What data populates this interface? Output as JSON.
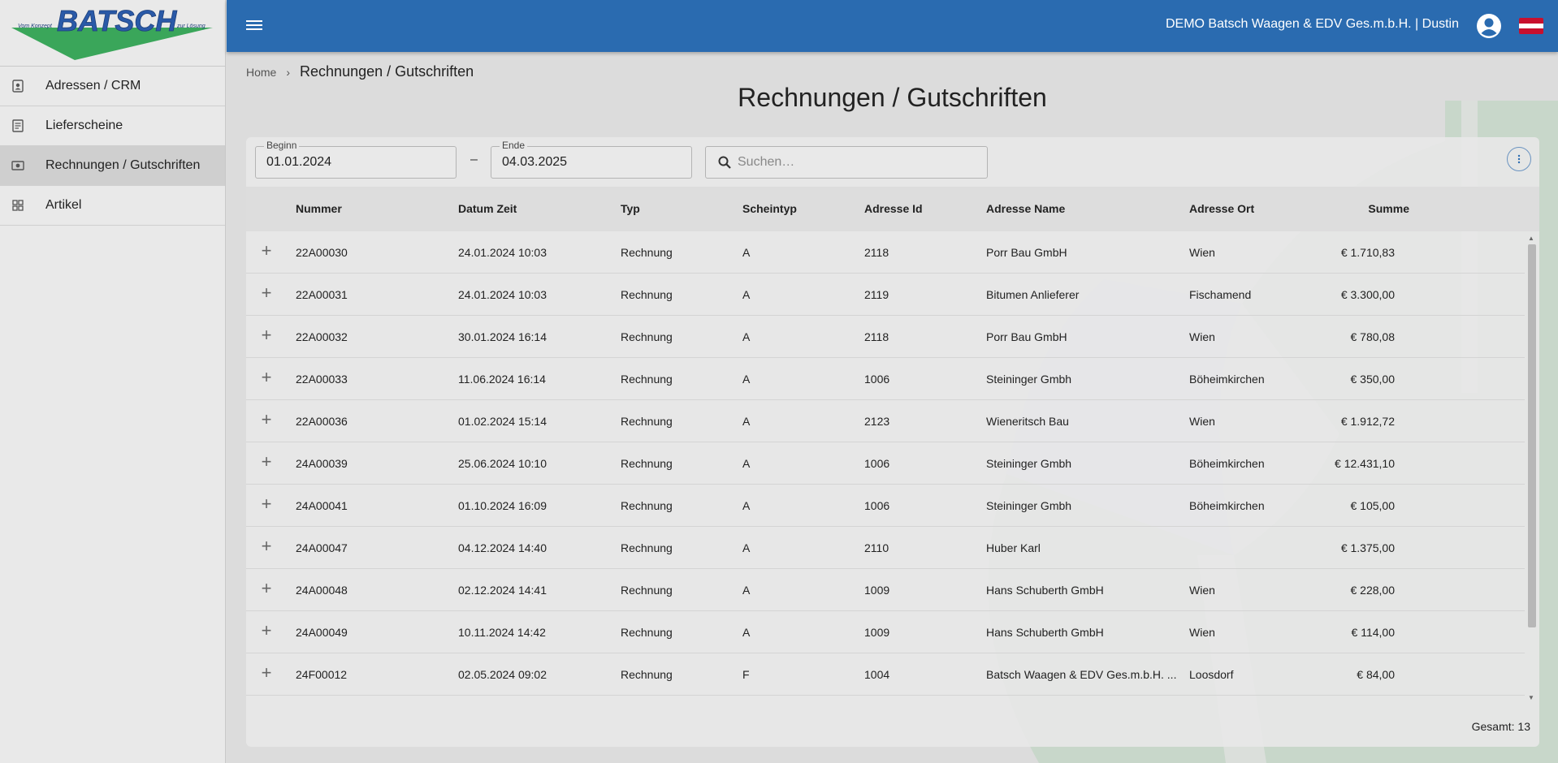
{
  "logo": {
    "brand": "BATSCH",
    "tagline_left": "Vom Konzept",
    "tagline_right": "zur Lösung",
    "colors": {
      "text": "#2a5aa8",
      "triangle": "#3aa65a"
    }
  },
  "sidebar": {
    "items": [
      {
        "label": "Adressen / CRM",
        "icon": "contact-icon",
        "active": false
      },
      {
        "label": "Lieferscheine",
        "icon": "document-icon",
        "active": false
      },
      {
        "label": "Rechnungen / Gutschriften",
        "icon": "money-icon",
        "active": true
      },
      {
        "label": "Artikel",
        "icon": "grid-icon",
        "active": false
      }
    ]
  },
  "header": {
    "title": "DEMO Batsch Waagen & EDV Ges.m.b.H. | Dustin",
    "color": "#2a6bb0",
    "menu_icon": "hamburger-icon",
    "user_icon": "account-circle-icon",
    "flag_icon": "austria-flag-icon",
    "flag_colors": [
      "#c8102e",
      "#ffffff",
      "#c8102e"
    ]
  },
  "breadcrumb": {
    "home": "Home",
    "current": "Rechnungen / Gutschriften"
  },
  "page": {
    "title": "Rechnungen / Gutschriften"
  },
  "filters": {
    "begin_label": "Beginn",
    "begin_value": "01.01.2024",
    "separator": "–",
    "end_label": "Ende",
    "end_value": "04.03.2025",
    "search_placeholder": "Suchen…"
  },
  "table": {
    "columns": {
      "nummer": "Nummer",
      "datum": "Datum Zeit",
      "typ": "Typ",
      "scheintyp": "Scheintyp",
      "adresse_id": "Adresse Id",
      "adresse_name": "Adresse Name",
      "adresse_ort": "Adresse Ort",
      "summe": "Summe"
    },
    "expand_symbol": "+",
    "rows": [
      {
        "nummer": "22A00030",
        "datum": "24.01.2024 10:03",
        "typ": "Rechnung",
        "scheintyp": "A",
        "adresse_id": "2118",
        "adresse_name": "Porr Bau GmbH",
        "adresse_ort": "Wien",
        "summe": "€ 1.710,83"
      },
      {
        "nummer": "22A00031",
        "datum": "24.01.2024 10:03",
        "typ": "Rechnung",
        "scheintyp": "A",
        "adresse_id": "2119",
        "adresse_name": "Bitumen Anlieferer",
        "adresse_ort": "Fischamend",
        "summe": "€ 3.300,00"
      },
      {
        "nummer": "22A00032",
        "datum": "30.01.2024 16:14",
        "typ": "Rechnung",
        "scheintyp": "A",
        "adresse_id": "2118",
        "adresse_name": "Porr Bau GmbH",
        "adresse_ort": "Wien",
        "summe": "€ 780,08"
      },
      {
        "nummer": "22A00033",
        "datum": "11.06.2024 16:14",
        "typ": "Rechnung",
        "scheintyp": "A",
        "adresse_id": "1006",
        "adresse_name": "Steininger Gmbh",
        "adresse_ort": "Böheimkirchen",
        "summe": "€ 350,00"
      },
      {
        "nummer": "22A00036",
        "datum": "01.02.2024 15:14",
        "typ": "Rechnung",
        "scheintyp": "A",
        "adresse_id": "2123",
        "adresse_name": "Wieneritsch Bau",
        "adresse_ort": "Wien",
        "summe": "€ 1.912,72"
      },
      {
        "nummer": "24A00039",
        "datum": "25.06.2024 10:10",
        "typ": "Rechnung",
        "scheintyp": "A",
        "adresse_id": "1006",
        "adresse_name": "Steininger Gmbh",
        "adresse_ort": "Böheimkirchen",
        "summe": "€ 12.431,10"
      },
      {
        "nummer": "24A00041",
        "datum": "01.10.2024 16:09",
        "typ": "Rechnung",
        "scheintyp": "A",
        "adresse_id": "1006",
        "adresse_name": "Steininger Gmbh",
        "adresse_ort": "Böheimkirchen",
        "summe": "€ 105,00"
      },
      {
        "nummer": "24A00047",
        "datum": "04.12.2024 14:40",
        "typ": "Rechnung",
        "scheintyp": "A",
        "adresse_id": "2110",
        "adresse_name": "Huber Karl",
        "adresse_ort": "",
        "summe": "€ 1.375,00"
      },
      {
        "nummer": "24A00048",
        "datum": "02.12.2024 14:41",
        "typ": "Rechnung",
        "scheintyp": "A",
        "adresse_id": "1009",
        "adresse_name": "Hans Schuberth GmbH",
        "adresse_ort": "Wien",
        "summe": "€ 228,00"
      },
      {
        "nummer": "24A00049",
        "datum": "10.11.2024 14:42",
        "typ": "Rechnung",
        "scheintyp": "A",
        "adresse_id": "1009",
        "adresse_name": "Hans Schuberth GmbH",
        "adresse_ort": "Wien",
        "summe": "€ 114,00"
      },
      {
        "nummer": "24F00012",
        "datum": "02.05.2024 09:02",
        "typ": "Rechnung",
        "scheintyp": "F",
        "adresse_id": "1004",
        "adresse_name": "Batsch Waagen & EDV Ges.m.b.H. ...",
        "adresse_ort": "Loosdorf",
        "summe": "€ 84,00"
      }
    ],
    "total": "Gesamt: 13"
  }
}
